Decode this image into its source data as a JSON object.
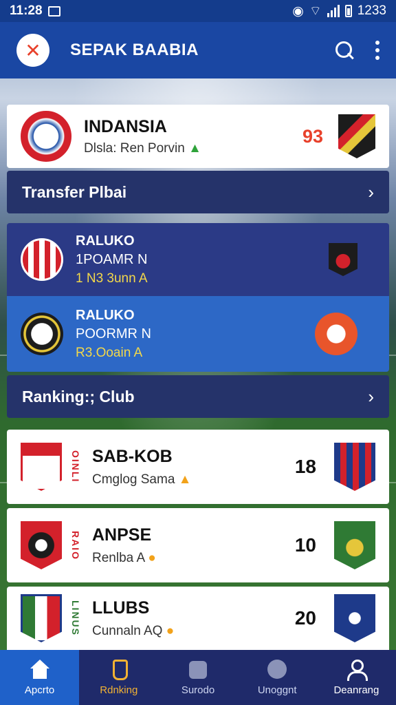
{
  "status_bar": {
    "time": "11:28",
    "right_text": "1233"
  },
  "app_bar": {
    "title": "SEPAK BAABIA"
  },
  "featured": {
    "name": "INDANSIA",
    "subtitle": "Dlsla: Ren Porvin",
    "score": "93"
  },
  "transfer_section": {
    "title": "Transfer Plbai",
    "items": [
      {
        "name": "RALUKO",
        "position": "1POAMR N",
        "fee": "1 N3 3unn A"
      },
      {
        "name": "RALUKO",
        "position": "POORMR N",
        "fee": "R3.Ooain A"
      }
    ]
  },
  "ranking_section": {
    "title": "Ranking:; Club",
    "items": [
      {
        "name": "SAB-KOB",
        "subtitle": "Cmglog Sama",
        "score": "18",
        "vertical_text": "OINLI"
      },
      {
        "name": "ANPSE",
        "subtitle": "Renlba A",
        "score": "10",
        "vertical_text": "RAIO"
      },
      {
        "name": "LLUBS",
        "subtitle": "Cunnaln AQ",
        "score": "20",
        "vertical_text": "LINUS"
      }
    ]
  },
  "bottom_nav": [
    {
      "label": "Apcrto",
      "icon": "home-icon"
    },
    {
      "label": "Rdnking",
      "icon": "trophy-icon"
    },
    {
      "label": "Surodo",
      "icon": "box-icon"
    },
    {
      "label": "Unoggnt",
      "icon": "dots-icon"
    },
    {
      "label": "Deanrang",
      "icon": "user-icon"
    }
  ],
  "colors": {
    "app_bar": "#1a47a3",
    "status_bar": "#143c8c",
    "accent_red": "#e8412b",
    "section_bg": "#25336a",
    "transfer_dark": "#2b3a86",
    "transfer_light": "#2d68c6",
    "nav_bg": "#1f2a6a",
    "nav_active": "#1f61c9"
  }
}
